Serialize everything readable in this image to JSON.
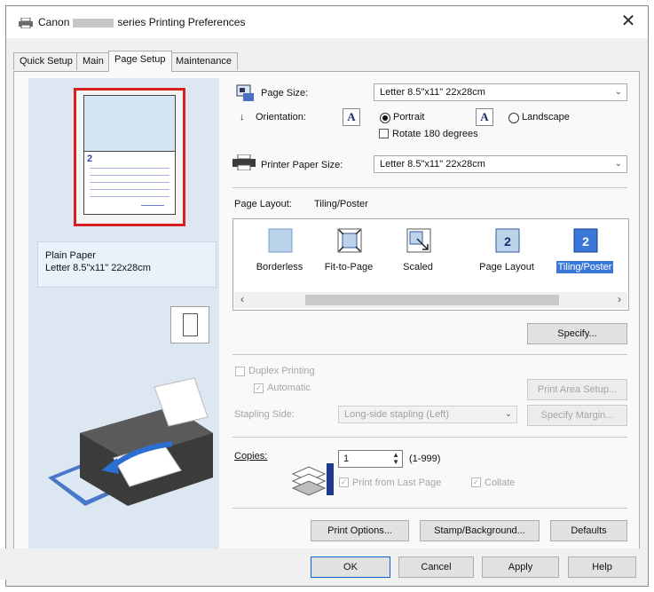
{
  "window": {
    "title_prefix": "Canon",
    "title_suffix": "series Printing Preferences",
    "close_glyph": "✕"
  },
  "tabs": [
    {
      "label": "Quick Setup"
    },
    {
      "label": "Main"
    },
    {
      "label": "Page Setup",
      "active": true
    },
    {
      "label": "Maintenance"
    }
  ],
  "preview": {
    "page_number": "2",
    "paper_type": "Plain Paper",
    "paper_size": "Letter 8.5\"x11\" 22x28cm"
  },
  "page_size": {
    "label": "Page Size:",
    "value": "Letter 8.5\"x11\" 22x28cm"
  },
  "orientation": {
    "label": "Orientation:",
    "portrait": "Portrait",
    "landscape": "Landscape",
    "rotate": "Rotate 180 degrees",
    "icon_glyph": "A"
  },
  "printer_paper_size": {
    "label": "Printer Paper Size:",
    "value": "Letter 8.5\"x11\" 22x28cm"
  },
  "page_layout": {
    "label": "Page Layout:",
    "value": "Tiling/Poster",
    "items": [
      {
        "label": "Borderless"
      },
      {
        "label": "Fit-to-Page"
      },
      {
        "label": "Scaled"
      },
      {
        "label": "Page Layout",
        "glyph": "2"
      },
      {
        "label": "Tiling/Poster",
        "glyph": "2",
        "selected": true
      }
    ],
    "scroll_left": "‹",
    "scroll_right": "›"
  },
  "buttons": {
    "specify": "Specify...",
    "print_area_setup": "Print Area Setup...",
    "specify_margin": "Specify Margin...",
    "print_options": "Print Options...",
    "stamp_background": "Stamp/Background...",
    "defaults": "Defaults",
    "ok": "OK",
    "cancel": "Cancel",
    "apply": "Apply",
    "help": "Help"
  },
  "duplex": {
    "label": "Duplex Printing",
    "automatic": "Automatic",
    "stapling_label": "Stapling Side:",
    "stapling_value": "Long-side stapling (Left)"
  },
  "copies": {
    "label": "Copies:",
    "value": "1",
    "range": "(1-999)",
    "print_from_last": "Print from Last Page",
    "collate": "Collate",
    "check_glyph": "✓"
  },
  "colors": {
    "highlight": "#3a78d8",
    "preview_frame": "#d82020"
  }
}
